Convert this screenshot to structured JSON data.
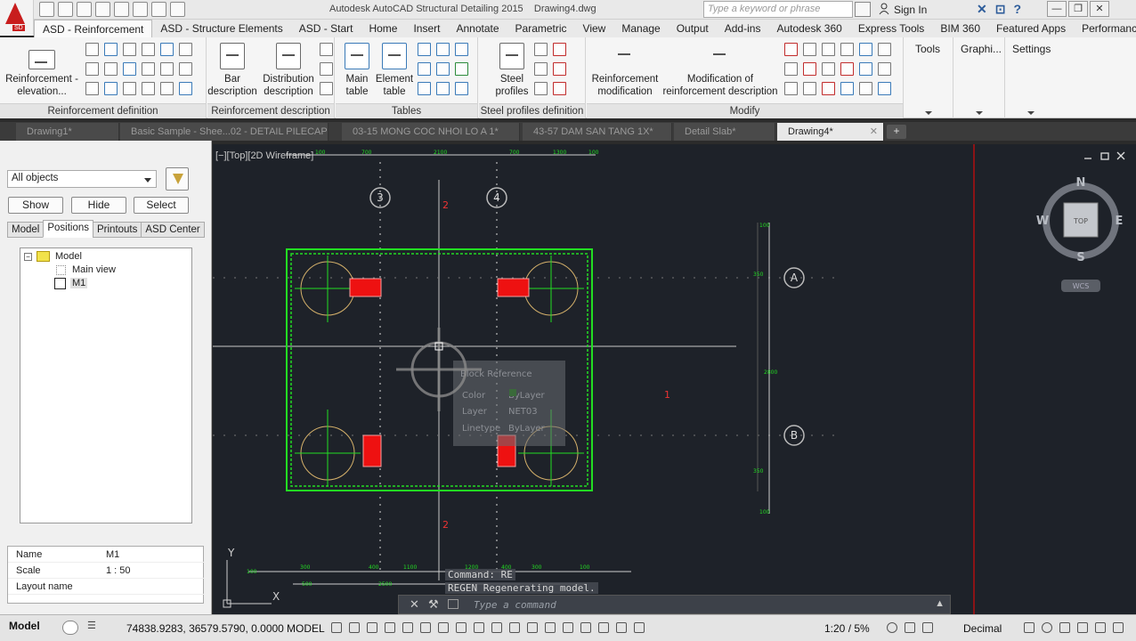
{
  "titlebar": {
    "app_title": "Autodesk AutoCAD Structural Detailing 2015",
    "doc_name": "Drawing4.dwg",
    "search_placeholder": "Type a keyword or phrase",
    "sign_in": "Sign In",
    "app_badge": "SD"
  },
  "ribbon_tabs": [
    "ASD - Reinforcement",
    "ASD - Structure Elements",
    "ASD - Start",
    "Home",
    "Insert",
    "Annotate",
    "Parametric",
    "View",
    "Manage",
    "Output",
    "Add-ins",
    "Autodesk 360",
    "Express Tools",
    "BIM 360",
    "Featured Apps",
    "Performance"
  ],
  "ribbon": {
    "reinf_elevation": "Reinforcement - elevation...",
    "panel_reinf_def": "Reinforcement definition",
    "bar_description": "Bar description",
    "distribution_description": "Distribution description",
    "panel_reinf_desc": "Reinforcement description",
    "main_table": "Main table",
    "element_table": "Element table",
    "panel_tables": "Tables",
    "steel_profiles": "Steel profiles",
    "panel_steel": "Steel profiles definition",
    "reinf_modification": "Reinforcement modification",
    "mod_reinf_desc": "Modification of reinforcement description",
    "panel_modify": "Modify",
    "tools": "Tools",
    "graphics": "Graphi...",
    "settings": "Settings"
  },
  "doc_tabs": [
    "Drawing1*",
    "Basic Sample - Shee...02 - DETAIL PILECAP*",
    "03-15  MONG COC NHOI LO A 1*",
    "43-57 DAM SAN TANG 1X*",
    "Detail Slab*",
    "Drawing4*"
  ],
  "left_panel": {
    "filter_value": "All objects",
    "show": "Show",
    "hide": "Hide",
    "select": "Select",
    "tabs": [
      "Model",
      "Positions",
      "Printouts",
      "ASD Center"
    ],
    "tree_root": "Model",
    "tree_child_1": "Main view",
    "tree_child_2": "M1",
    "props": [
      {
        "k": "Name",
        "v": "M1"
      },
      {
        "k": "Scale",
        "v": "1 : 50"
      },
      {
        "k": "Layout name",
        "v": ""
      }
    ]
  },
  "canvas": {
    "viewport_label": "[−][Top][2D Wireframe]",
    "axis_3": "3",
    "axis_4": "4",
    "axis_a": "A",
    "axis_b": "B",
    "marker_2": "2",
    "marker_1": "1",
    "compass_n": "N",
    "compass_s": "S",
    "compass_e": "E",
    "compass_w": "W",
    "compass_top": "TOP",
    "wcs": "WCS",
    "tooltip_title": "Block Reference",
    "tooltip_color_k": "Color",
    "tooltip_color_v": "ByLayer",
    "tooltip_layer_k": "Layer",
    "tooltip_layer_v": "NET03",
    "tooltip_ltype_k": "Linetype",
    "tooltip_ltype_v": "ByLayer",
    "ucs_y": "Y",
    "ucs_x": "X",
    "dim_labels_top": [
      "100",
      "700",
      "2100",
      "700",
      "1300",
      "100"
    ],
    "dim_labels_bottom": [
      "100",
      "300",
      "400",
      "1100",
      "1200",
      "400",
      "300",
      "100",
      "500",
      "2500"
    ],
    "dim_labels_right": [
      "100",
      "350",
      "2800",
      "350",
      "100"
    ]
  },
  "command": {
    "history_1": "Command: RE",
    "history_2": "REGEN Regenerating model.",
    "placeholder": "Type a command"
  },
  "statusbar": {
    "model_tab": "Model",
    "coords": "74838.9283, 36579.5790, 0.0000",
    "model": "MODEL",
    "scale": "1:20 / 5%",
    "units": "Decimal"
  },
  "colors": {
    "canvas_bg": "#1e2229",
    "pilecap_green": "#22dd22",
    "bar_red": "#ee1111",
    "axis_line": "#c8c8c8"
  }
}
